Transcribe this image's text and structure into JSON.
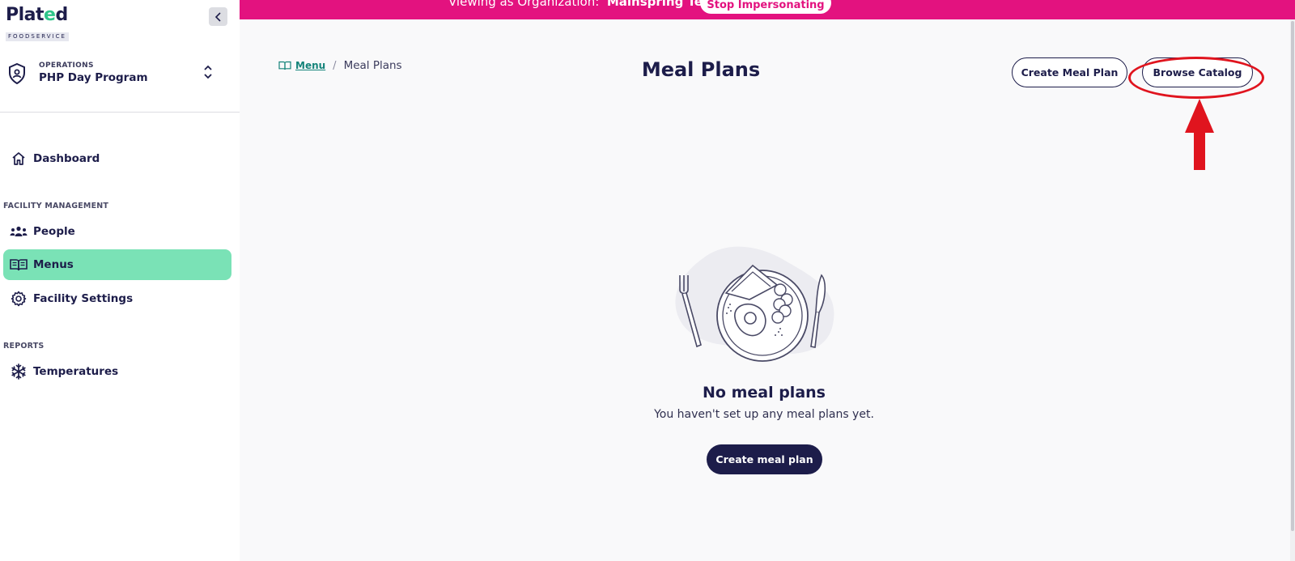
{
  "brand": {
    "name_part1": "Plat",
    "name_dot": "e",
    "name_part2": "d",
    "sub": "FOODSERVICE"
  },
  "org_switcher": {
    "label": "OPERATIONS",
    "name": "PHP Day Program"
  },
  "sidebar": {
    "dashboard": "Dashboard",
    "facility_section": "FACILITY MANAGEMENT",
    "items": [
      {
        "label": "People",
        "icon": "people-icon"
      },
      {
        "label": "Menus",
        "icon": "book-icon",
        "active": true
      },
      {
        "label": "Facility Settings",
        "icon": "gear-icon"
      }
    ],
    "reports_section": "REPORTS",
    "reports_items": [
      {
        "label": "Temperatures",
        "icon": "snowflake-icon"
      }
    ]
  },
  "banner": {
    "prefix": "Viewing as Organization:",
    "org": "Mainspring Test",
    "button": "Stop Impersonating",
    "color": "#e3127f"
  },
  "breadcrumb": {
    "link": "Menu",
    "current": "Meal Plans"
  },
  "page": {
    "title": "Meal Plans",
    "create_button": "Create Meal Plan",
    "browse_button": "Browse Catalog"
  },
  "empty_state": {
    "title": "No meal plans",
    "subtitle": "You haven't set up any meal plans yet.",
    "button": "Create meal plan"
  },
  "colors": {
    "accent_green": "#7ae2b6",
    "navy": "#1d1d4a",
    "annotation_red": "#e0141e"
  }
}
